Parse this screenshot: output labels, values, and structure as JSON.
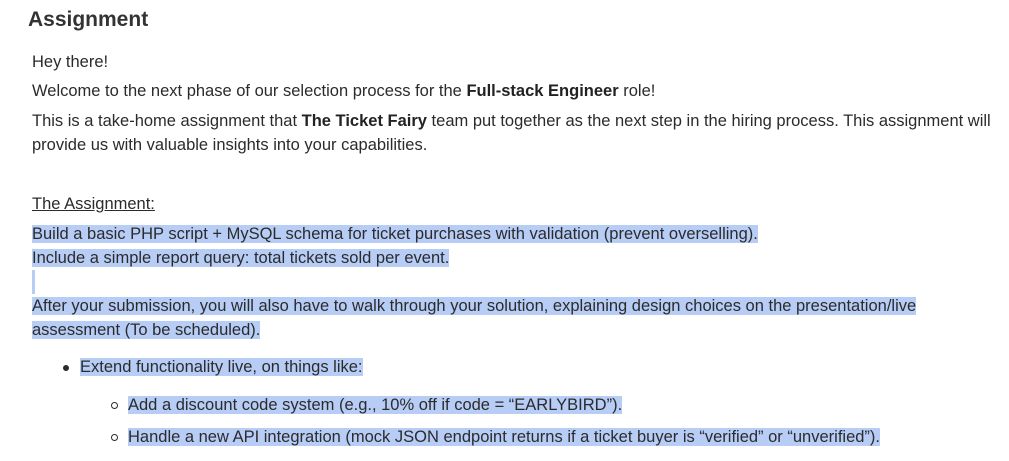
{
  "title": "Assignment",
  "greeting": "Hey there!",
  "welcome": {
    "pre": "Welcome to the next phase of our selection process for the ",
    "role": "Full-stack Engineer",
    "post": " role!"
  },
  "intro": {
    "pre": "This is a take-home assignment that ",
    "team": "The Ticket Fairy",
    "post": " team put together as the next step in the hiring process. This assignment will provide us with valuable insights into your capabilities."
  },
  "assignment_heading": "The Assignment:",
  "task_line1": "Build a basic PHP script + MySQL schema for ticket purchases with validation (prevent overselling).",
  "task_line2": "Include a simple report query: total tickets sold per event.",
  "after_submission_line1": "After your submission, you will also have to walk through your solution, explaining design choices on the presentation/live",
  "after_submission_line2": "assessment (To be scheduled).",
  "bullet_main": "Extend functionality live, on things like:",
  "sub_bullets": [
    "Add a discount code system (e.g., 10% off if code = “EARLYBIRD”).",
    "Handle a new API integration (mock JSON endpoint returns if a ticket buyer is “verified” or “unverified”)."
  ],
  "selection_color": "#b7cdf6"
}
